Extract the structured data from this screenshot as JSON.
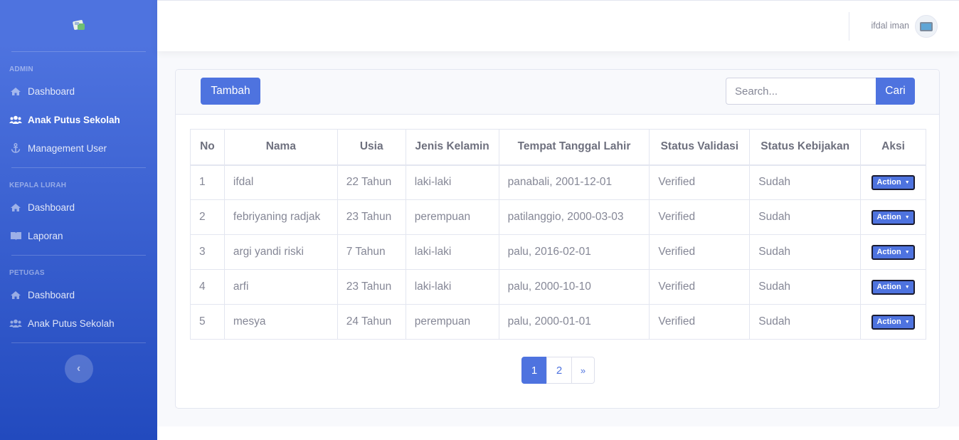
{
  "sidebar": {
    "sections": [
      {
        "heading": "ADMIN",
        "items": [
          {
            "label": "Dashboard",
            "icon": "home-icon"
          },
          {
            "label": "Anak Putus Sekolah",
            "icon": "users-icon",
            "active": true
          },
          {
            "label": "Management User",
            "icon": "anchor-icon"
          }
        ]
      },
      {
        "heading": "KEPALA LURAH",
        "items": [
          {
            "label": "Dashboard",
            "icon": "home-icon"
          },
          {
            "label": "Laporan",
            "icon": "book-icon"
          }
        ]
      },
      {
        "heading": "PETUGAS",
        "items": [
          {
            "label": "Dashboard",
            "icon": "home-icon"
          },
          {
            "label": "Anak Putus Sekolah",
            "icon": "users-icon"
          }
        ]
      }
    ],
    "toggle_icon": "‹"
  },
  "topbar": {
    "user_name": "ifdal iman"
  },
  "card": {
    "add_label": "Tambah",
    "search_placeholder": "Search...",
    "search_button": "Cari"
  },
  "table": {
    "headers": [
      "No",
      "Nama",
      "Usia",
      "Jenis Kelamin",
      "Tempat Tanggal Lahir",
      "Status Validasi",
      "Status Kebijakan",
      "Aksi"
    ],
    "action_label": "Action",
    "rows": [
      {
        "no": "1",
        "nama": "ifdal",
        "usia": "22 Tahun",
        "jk": "laki-laki",
        "ttl": "panabali, 2001-12-01",
        "validasi": "Verified",
        "kebijakan": "Sudah"
      },
      {
        "no": "2",
        "nama": "febriyaning radjak",
        "usia": "23 Tahun",
        "jk": "perempuan",
        "ttl": "patilanggio, 2000-03-03",
        "validasi": "Verified",
        "kebijakan": "Sudah"
      },
      {
        "no": "3",
        "nama": "argi yandi riski",
        "usia": "7 Tahun",
        "jk": "laki-laki",
        "ttl": "palu, 2016-02-01",
        "validasi": "Verified",
        "kebijakan": "Sudah"
      },
      {
        "no": "4",
        "nama": "arfi",
        "usia": "23 Tahun",
        "jk": "laki-laki",
        "ttl": "palu, 2000-10-10",
        "validasi": "Verified",
        "kebijakan": "Sudah"
      },
      {
        "no": "5",
        "nama": "mesya",
        "usia": "24 Tahun",
        "jk": "perempuan",
        "ttl": "palu, 2000-01-01",
        "validasi": "Verified",
        "kebijakan": "Sudah"
      }
    ]
  },
  "pagination": {
    "pages": [
      "1",
      "2"
    ],
    "active": "1",
    "next": "»"
  },
  "colors": {
    "primary": "#4e73df",
    "sidebar_gradient_end": "#224abe"
  }
}
